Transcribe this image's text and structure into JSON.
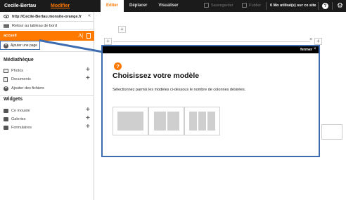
{
  "header": {
    "site_name": "Cecile-Bertau",
    "modify_link": "Modifier",
    "tabs": [
      "Editer",
      "Déplacer",
      "Visualiser"
    ],
    "save_label": "Sauvegarder",
    "publish_label": "Publier",
    "usage": "0 Mo utilisé(s) sur ce site",
    "help_glyph": "?",
    "settings_glyph": "⚙"
  },
  "sidebar": {
    "site_url": "http://Cecile-Bertau.monsite-orange.fr",
    "collapse_glyph": "«",
    "back_label": "Retour au tableau de bord",
    "current_page": "accueil",
    "add_page_label": "Ajouter une page",
    "media_title": "Médiathèque",
    "media_items": [
      "Photos",
      "Documents"
    ],
    "add_files_label": "Ajouter des fichiers",
    "widgets_title": "Widgets",
    "widget_items": [
      "Ce mouste",
      "Galeries",
      "Formulaires"
    ]
  },
  "modal": {
    "close_label": "fermer",
    "close_glyph": "×",
    "help_glyph": "?",
    "title": "Choisissez votre modèle",
    "description": "Sélectionnez parmis les modèles ci-dessous le nombre de colonnes désirées.",
    "layouts": [
      1,
      2,
      3
    ]
  },
  "colors": {
    "accent": "#ff7900",
    "topbar": "#1b1b1b",
    "highlight_border": "#3d6cb0"
  }
}
